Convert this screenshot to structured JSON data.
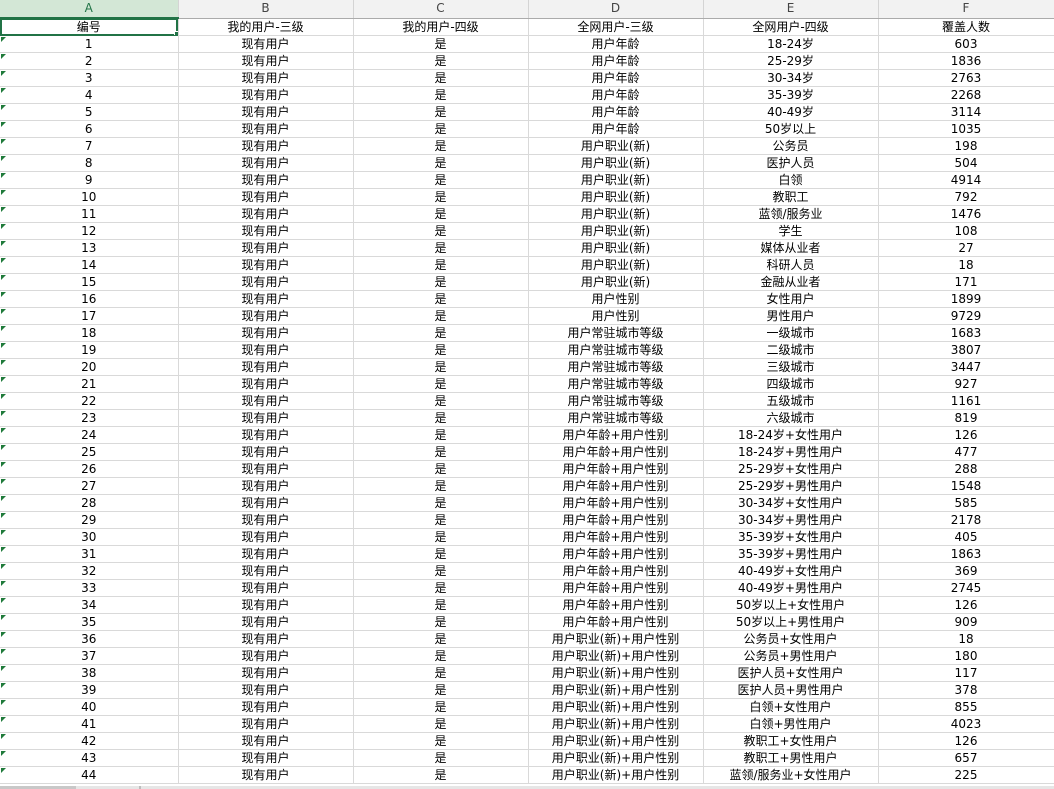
{
  "columns": [
    "A",
    "B",
    "C",
    "D",
    "E",
    "F"
  ],
  "header_row": [
    "编号",
    "我的用户-三级",
    "我的用户-四级",
    "全网用户-三级",
    "全网用户-四级",
    "覆盖人数"
  ],
  "active_cell": "A1",
  "accent_color": "#217346",
  "error_indicator_color": "#1f7a3a",
  "rows": [
    [
      "1",
      "现有用户",
      "是",
      "用户年龄",
      "18-24岁",
      "603"
    ],
    [
      "2",
      "现有用户",
      "是",
      "用户年龄",
      "25-29岁",
      "1836"
    ],
    [
      "3",
      "现有用户",
      "是",
      "用户年龄",
      "30-34岁",
      "2763"
    ],
    [
      "4",
      "现有用户",
      "是",
      "用户年龄",
      "35-39岁",
      "2268"
    ],
    [
      "5",
      "现有用户",
      "是",
      "用户年龄",
      "40-49岁",
      "3114"
    ],
    [
      "6",
      "现有用户",
      "是",
      "用户年龄",
      "50岁以上",
      "1035"
    ],
    [
      "7",
      "现有用户",
      "是",
      "用户职业(新)",
      "公务员",
      "198"
    ],
    [
      "8",
      "现有用户",
      "是",
      "用户职业(新)",
      "医护人员",
      "504"
    ],
    [
      "9",
      "现有用户",
      "是",
      "用户职业(新)",
      "白领",
      "4914"
    ],
    [
      "10",
      "现有用户",
      "是",
      "用户职业(新)",
      "教职工",
      "792"
    ],
    [
      "11",
      "现有用户",
      "是",
      "用户职业(新)",
      "蓝领/服务业",
      "1476"
    ],
    [
      "12",
      "现有用户",
      "是",
      "用户职业(新)",
      "学生",
      "108"
    ],
    [
      "13",
      "现有用户",
      "是",
      "用户职业(新)",
      "媒体从业者",
      "27"
    ],
    [
      "14",
      "现有用户",
      "是",
      "用户职业(新)",
      "科研人员",
      "18"
    ],
    [
      "15",
      "现有用户",
      "是",
      "用户职业(新)",
      "金融从业者",
      "171"
    ],
    [
      "16",
      "现有用户",
      "是",
      "用户性别",
      "女性用户",
      "1899"
    ],
    [
      "17",
      "现有用户",
      "是",
      "用户性别",
      "男性用户",
      "9729"
    ],
    [
      "18",
      "现有用户",
      "是",
      "用户常驻城市等级",
      "一级城市",
      "1683"
    ],
    [
      "19",
      "现有用户",
      "是",
      "用户常驻城市等级",
      "二级城市",
      "3807"
    ],
    [
      "20",
      "现有用户",
      "是",
      "用户常驻城市等级",
      "三级城市",
      "3447"
    ],
    [
      "21",
      "现有用户",
      "是",
      "用户常驻城市等级",
      "四级城市",
      "927"
    ],
    [
      "22",
      "现有用户",
      "是",
      "用户常驻城市等级",
      "五级城市",
      "1161"
    ],
    [
      "23",
      "现有用户",
      "是",
      "用户常驻城市等级",
      "六级城市",
      "819"
    ],
    [
      "24",
      "现有用户",
      "是",
      "用户年龄+用户性别",
      "18-24岁+女性用户",
      "126"
    ],
    [
      "25",
      "现有用户",
      "是",
      "用户年龄+用户性别",
      "18-24岁+男性用户",
      "477"
    ],
    [
      "26",
      "现有用户",
      "是",
      "用户年龄+用户性别",
      "25-29岁+女性用户",
      "288"
    ],
    [
      "27",
      "现有用户",
      "是",
      "用户年龄+用户性别",
      "25-29岁+男性用户",
      "1548"
    ],
    [
      "28",
      "现有用户",
      "是",
      "用户年龄+用户性别",
      "30-34岁+女性用户",
      "585"
    ],
    [
      "29",
      "现有用户",
      "是",
      "用户年龄+用户性别",
      "30-34岁+男性用户",
      "2178"
    ],
    [
      "30",
      "现有用户",
      "是",
      "用户年龄+用户性别",
      "35-39岁+女性用户",
      "405"
    ],
    [
      "31",
      "现有用户",
      "是",
      "用户年龄+用户性别",
      "35-39岁+男性用户",
      "1863"
    ],
    [
      "32",
      "现有用户",
      "是",
      "用户年龄+用户性别",
      "40-49岁+女性用户",
      "369"
    ],
    [
      "33",
      "现有用户",
      "是",
      "用户年龄+用户性别",
      "40-49岁+男性用户",
      "2745"
    ],
    [
      "34",
      "现有用户",
      "是",
      "用户年龄+用户性别",
      "50岁以上+女性用户",
      "126"
    ],
    [
      "35",
      "现有用户",
      "是",
      "用户年龄+用户性别",
      "50岁以上+男性用户",
      "909"
    ],
    [
      "36",
      "现有用户",
      "是",
      "用户职业(新)+用户性别",
      "公务员+女性用户",
      "18"
    ],
    [
      "37",
      "现有用户",
      "是",
      "用户职业(新)+用户性别",
      "公务员+男性用户",
      "180"
    ],
    [
      "38",
      "现有用户",
      "是",
      "用户职业(新)+用户性别",
      "医护人员+女性用户",
      "117"
    ],
    [
      "39",
      "现有用户",
      "是",
      "用户职业(新)+用户性别",
      "医护人员+男性用户",
      "378"
    ],
    [
      "40",
      "现有用户",
      "是",
      "用户职业(新)+用户性别",
      "白领+女性用户",
      "855"
    ],
    [
      "41",
      "现有用户",
      "是",
      "用户职业(新)+用户性别",
      "白领+男性用户",
      "4023"
    ],
    [
      "42",
      "现有用户",
      "是",
      "用户职业(新)+用户性别",
      "教职工+女性用户",
      "126"
    ],
    [
      "43",
      "现有用户",
      "是",
      "用户职业(新)+用户性别",
      "教职工+男性用户",
      "657"
    ],
    [
      "44",
      "现有用户",
      "是",
      "用户职业(新)+用户性别",
      "蓝领/服务业+女性用户",
      "225"
    ]
  ]
}
